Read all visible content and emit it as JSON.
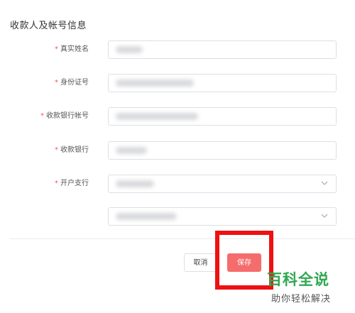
{
  "section_title": "收款人及帐号信息",
  "form": {
    "fields": [
      {
        "label": "真实姓名",
        "required": true,
        "type": "text"
      },
      {
        "label": "身份证号",
        "required": true,
        "type": "text"
      },
      {
        "label": "收款银行帐号",
        "required": true,
        "type": "text"
      },
      {
        "label": "收款银行",
        "required": true,
        "type": "text"
      },
      {
        "label": "开户支行",
        "required": true,
        "type": "select"
      },
      {
        "label": "",
        "required": false,
        "type": "select"
      }
    ],
    "required_mark": "*"
  },
  "actions": {
    "cancel_label": "取消",
    "save_label": "保存"
  },
  "watermark": {
    "title": "百科全说",
    "subtitle": "助你轻松解决"
  },
  "colors": {
    "primary_button": "#f56c6c",
    "required_mark": "#f15a5a",
    "highlight_border": "#ee1111",
    "watermark_green": "#2fa84f"
  }
}
